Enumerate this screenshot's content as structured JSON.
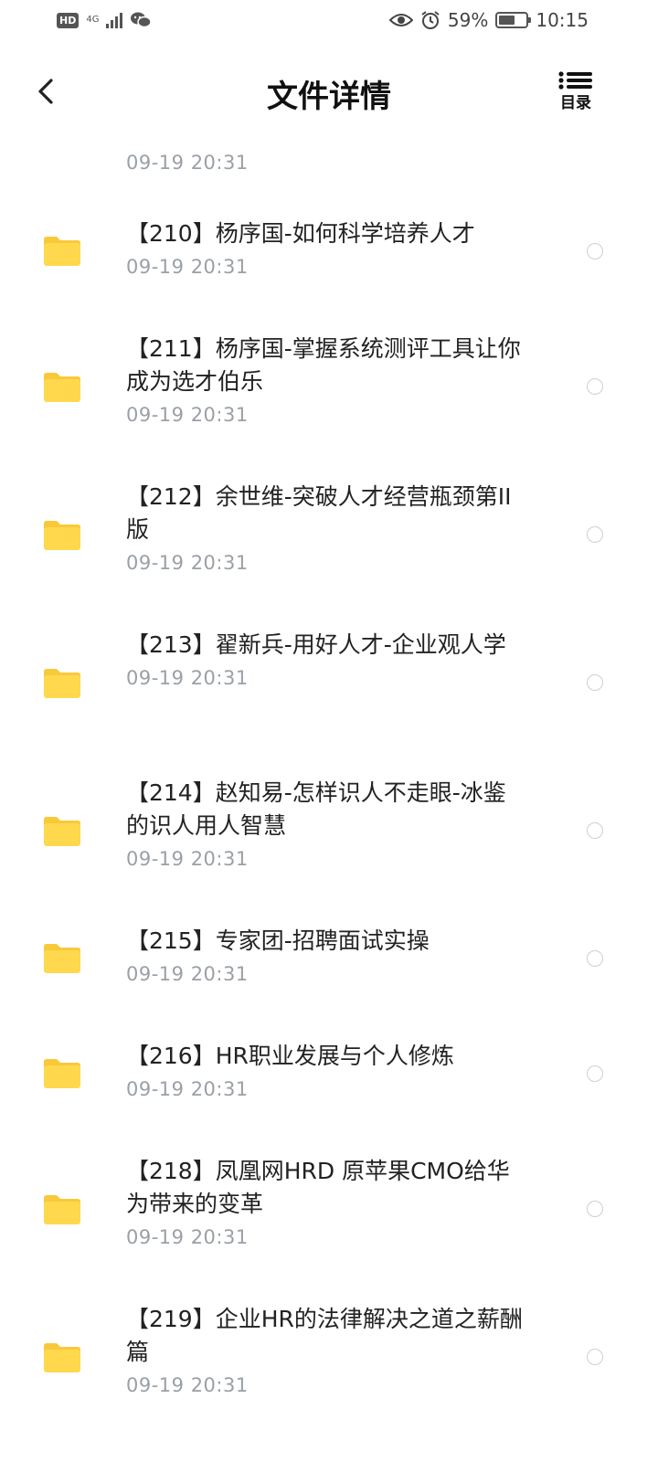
{
  "status_bar": {
    "hd": "HD",
    "network": "4G",
    "battery_percent": "59%",
    "battery_level": 0.59,
    "time": "10:15",
    "icons": [
      "hd-badge",
      "signal-icon",
      "wechat-icon",
      "eye-icon",
      "alarm-icon",
      "battery-icon"
    ]
  },
  "header": {
    "title": "文件详情",
    "toc_label": "目录",
    "back_icon": "chevron-left-icon",
    "toc_icon": "list-icon"
  },
  "colors": {
    "folder": "#FFD84D",
    "folder_tab": "#F9C93A",
    "date": "#9AA0A6",
    "radio_border": "#CFCFCF"
  },
  "files": [
    {
      "name": "",
      "date": "09-19  20:31"
    },
    {
      "name": "【210】杨序国-如何科学培养人才",
      "date": "09-19  20:31"
    },
    {
      "name": "【211】杨序国-掌握系统测评工具让你成为选才伯乐",
      "date": "09-19  20:31"
    },
    {
      "name": "【212】余世维-突破人才经营瓶颈第II版",
      "date": "09-19  20:31"
    },
    {
      "name": "【213】翟新兵-用好人才-企业观人学",
      "date": "09-19  20:31"
    },
    {
      "name": "【214】赵知易-怎样识人不走眼-冰鉴的识人用人智慧",
      "date": "09-19  20:31"
    },
    {
      "name": "【215】专家团-招聘面试实操",
      "date": "09-19  20:31"
    },
    {
      "name": "【216】HR职业发展与个人修炼",
      "date": "09-19  20:31"
    },
    {
      "name": "【218】凤凰网HRD 原苹果CMO给华为带来的变革",
      "date": "09-19  20:31"
    },
    {
      "name": "【219】企业HR的法律解决之道之薪酬篇",
      "date": "09-19  20:31"
    }
  ]
}
